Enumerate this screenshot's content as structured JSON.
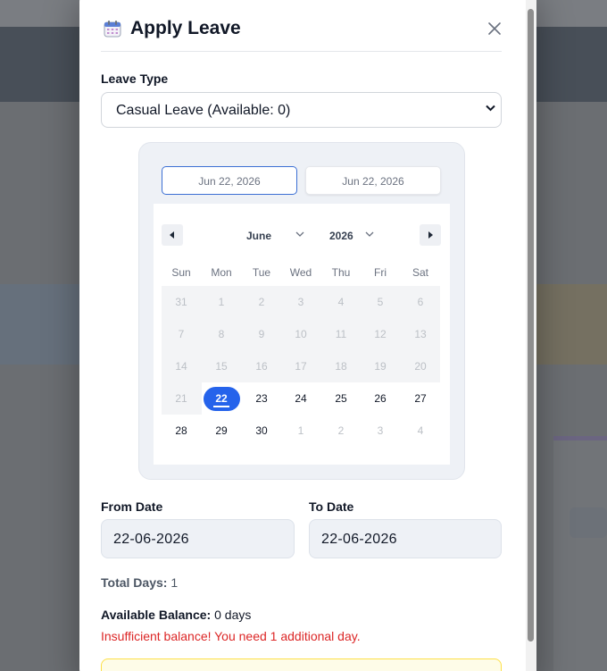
{
  "modal": {
    "title": "Apply Leave",
    "calendar_icon": "calendar-icon",
    "close_icon": "close-icon"
  },
  "leave_type": {
    "label": "Leave Type",
    "selected": "Casual Leave (Available: 0)"
  },
  "date_range": {
    "from_display": "Jun 22, 2026",
    "to_display": "Jun 22, 2026"
  },
  "calendar": {
    "month": "June",
    "year": "2026",
    "weekdays": [
      "Sun",
      "Mon",
      "Tue",
      "Wed",
      "Thu",
      "Fri",
      "Sat"
    ],
    "weeks": [
      [
        "31",
        "1",
        "2",
        "3",
        "4",
        "5",
        "6"
      ],
      [
        "7",
        "8",
        "9",
        "10",
        "11",
        "12",
        "13"
      ],
      [
        "14",
        "15",
        "16",
        "17",
        "18",
        "19",
        "20"
      ],
      [
        "21",
        "22",
        "23",
        "24",
        "25",
        "26",
        "27"
      ],
      [
        "28",
        "29",
        "30",
        "1",
        "2",
        "3",
        "4"
      ]
    ],
    "selected_day": "22",
    "accent_color": "#2563eb"
  },
  "from_date": {
    "label": "From Date",
    "value": "22-06-2026"
  },
  "to_date": {
    "label": "To Date",
    "value": "22-06-2026"
  },
  "summary": {
    "total_label": "Total Days:",
    "total_value": "1",
    "balance_label": "Available Balance:",
    "balance_value": "0 days",
    "error": "Insufficient balance! You need 1 additional day."
  },
  "colors": {
    "error": "#dc2626",
    "header_dark": "#1f2937"
  }
}
